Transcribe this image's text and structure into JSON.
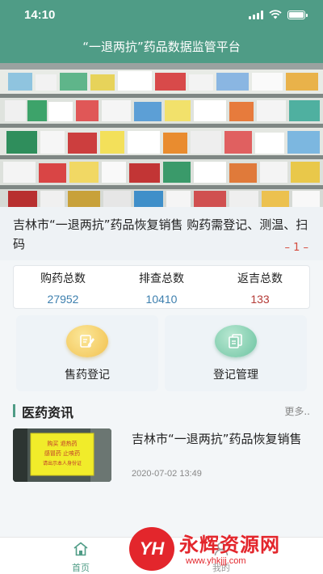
{
  "status_bar": {
    "time": "14:10"
  },
  "header": {
    "title": "“一退两抗”药品数据监管平台"
  },
  "news_ticker": {
    "text": "吉林市“一退两抗”药品恢复销售 购药需登记、测温、扫码",
    "page": "– 1 –"
  },
  "stats": [
    {
      "label": "购药总数",
      "value": "27952",
      "color": "#3d7fae"
    },
    {
      "label": "排查总数",
      "value": "10410",
      "color": "#3d7fae"
    },
    {
      "label": "返吉总数",
      "value": "133",
      "color": "#b43a36"
    }
  ],
  "actions": [
    {
      "label": "售药登记",
      "icon": "edit-icon"
    },
    {
      "label": "登记管理",
      "icon": "documents-icon"
    }
  ],
  "section": {
    "title": "医药资讯",
    "more": "更多.."
  },
  "articles": [
    {
      "title": "吉林市“一退两抗”药品恢复销售",
      "date": "2020-07-02 13:49",
      "thumb_text": [
        "购买 退热药",
        "感冒药 止咳药",
        "请出示本人身份证"
      ]
    }
  ],
  "tab_bar": [
    {
      "label": "首页",
      "icon": "home-icon",
      "active": true
    },
    {
      "label": "我的",
      "icon": "person-icon",
      "active": false
    }
  ],
  "watermark": {
    "logo": "YH",
    "name": "永辉资源网",
    "url": "www.yhkjjj.com"
  }
}
